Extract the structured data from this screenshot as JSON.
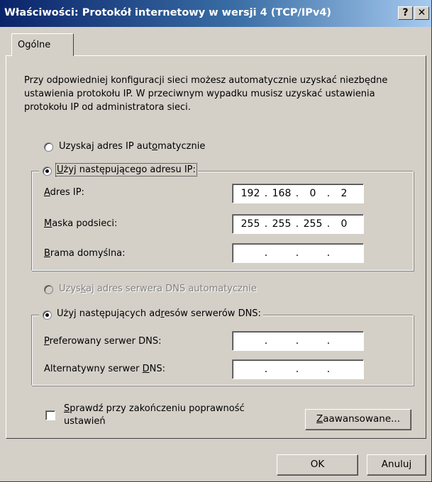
{
  "window": {
    "title": "Właściwości: Protokół internetowy w wersji 4 (TCP/IPv4)",
    "help_glyph": "?",
    "close_glyph": "✕"
  },
  "tabs": [
    {
      "label": "Ogólne",
      "selected": true
    }
  ],
  "description": "Przy odpowiedniej konfiguracji sieci możesz automatycznie uzyskać niezbędne ustawienia protokołu IP. W przeciwnym wypadku musisz uzyskać ustawienia protokołu IP od administratora sieci.",
  "ip": {
    "auto_label": "Uzyskaj adres IP automatycznie",
    "auto_checked": false,
    "manual_label": "Użyj następującego adresu IP:",
    "manual_checked": true,
    "address_label": "Adres IP:",
    "address": [
      "192",
      "168",
      "0",
      "2"
    ],
    "mask_label": "Maska podsieci:",
    "mask": [
      "255",
      "255",
      "255",
      "0"
    ],
    "gateway_label": "Brama domyślna:",
    "gateway": [
      "",
      "",
      "",
      ""
    ]
  },
  "dns": {
    "auto_label": "Uzyskaj adres serwera DNS automatycznie",
    "auto_enabled": false,
    "manual_label": "Użyj następujących adresów serwerów DNS:",
    "manual_checked": true,
    "preferred_label": "Preferowany serwer DNS:",
    "preferred": [
      "",
      "",
      "",
      ""
    ],
    "alternate_label": "Alternatywny serwer DNS:",
    "alternate": [
      "",
      "",
      "",
      ""
    ]
  },
  "validate": {
    "label_line1": "Sprawdź przy zakończeniu poprawność",
    "label_line2": "ustawień",
    "checked": false
  },
  "buttons": {
    "advanced": "Zaawansowane...",
    "ok": "OK",
    "cancel": "Anuluj"
  },
  "dot": "."
}
